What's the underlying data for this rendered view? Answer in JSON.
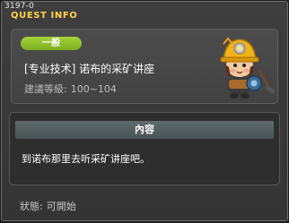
{
  "window": {
    "quest_id": "3197-0",
    "title": "QUEST INFO"
  },
  "quest": {
    "category": "一般",
    "name": "[专业技术] 诺布的采矿讲座",
    "level_label": "建議等級:",
    "level_range": "100~104"
  },
  "content": {
    "header": "內容",
    "text": "到诺布那里去听采矿讲座吧。"
  },
  "status": {
    "label": "狀態:",
    "value": "可開始"
  },
  "colors": {
    "title": "#ffd44a",
    "badge": "#8fc02a",
    "panel": "#474747",
    "content_header": "#55605f"
  },
  "icons": {
    "npc": "miner-npc-icon"
  }
}
